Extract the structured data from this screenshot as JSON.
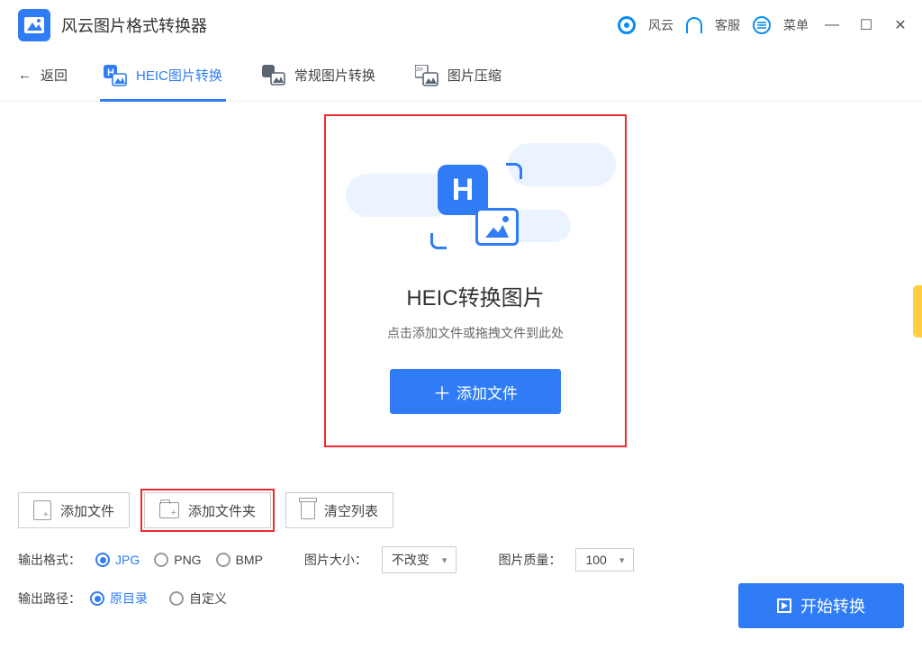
{
  "titlebar": {
    "app_title": "风云图片格式转换器",
    "fy_label": "风云",
    "service_label": "客服",
    "menu_label": "菜单"
  },
  "toolbar": {
    "back": "返回",
    "tabs": [
      {
        "label": "HEIC图片转换"
      },
      {
        "label": "常规图片转换"
      },
      {
        "label": "图片压缩"
      }
    ]
  },
  "dropzone": {
    "title": "HEIC转换图片",
    "subtitle": "点击添加文件或拖拽文件到此处",
    "add_button": "添加文件"
  },
  "actions": {
    "add_file": "添加文件",
    "add_folder": "添加文件夹",
    "clear_list": "清空列表"
  },
  "options": {
    "format_label": "输出格式：",
    "formats": [
      "JPG",
      "PNG",
      "BMP"
    ],
    "size_label": "图片大小：",
    "size_value": "不改变",
    "quality_label": "图片质量：",
    "quality_value": "100"
  },
  "path": {
    "label": "输出路径：",
    "original": "原目录",
    "custom": "自定义"
  },
  "start_button": "开始转换"
}
